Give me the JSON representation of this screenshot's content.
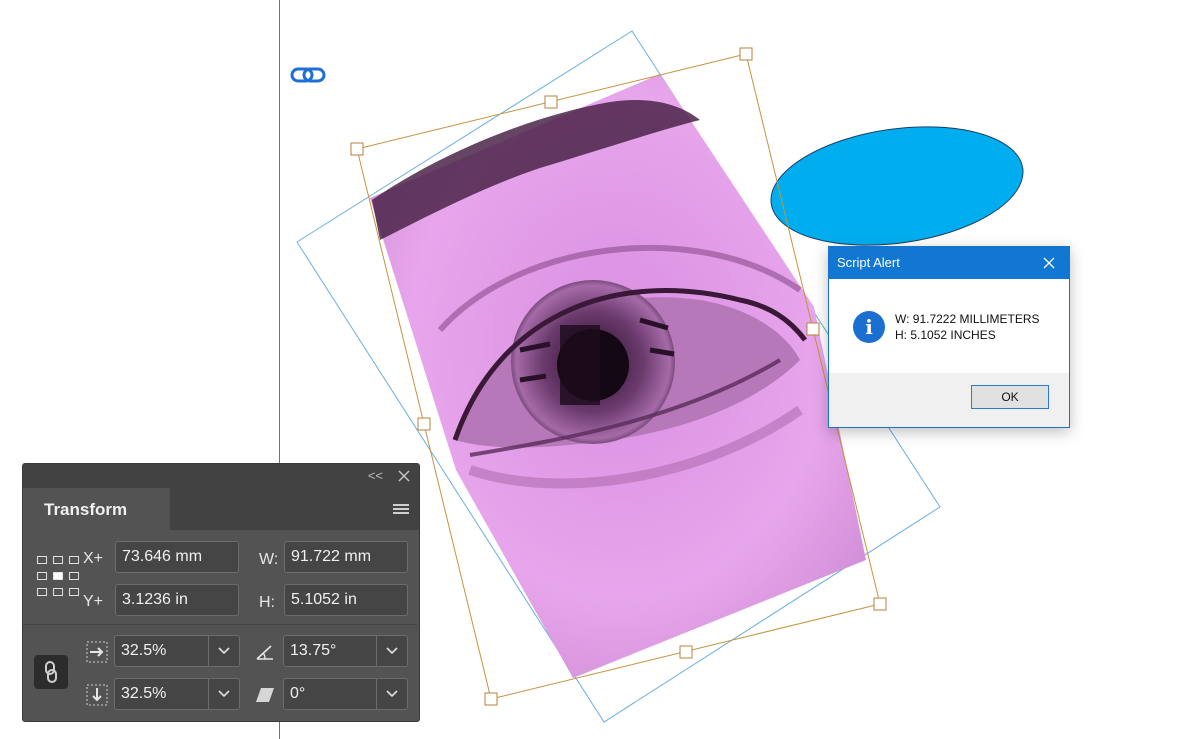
{
  "dialog": {
    "title": "Script Alert",
    "line1": "W: 91.7222 MILLIMETERS",
    "line2": "H: 5.1052 INCHES",
    "info_glyph": "i",
    "ok_label": "OK"
  },
  "panel": {
    "collapse_glyph": "<<",
    "tab_label": "Transform",
    "x_label": "X+",
    "y_label": "Y+",
    "w_label": "W:",
    "h_label": "H:",
    "x_value": "73.646 mm",
    "y_value": "3.1236 in",
    "w_value": "91.722 mm",
    "h_value": "5.1052 in",
    "scale_x": "32.5%",
    "scale_y": "32.5%",
    "rotation": "13.75°",
    "shear": "0°"
  },
  "colors": {
    "guide": "#c03cc0",
    "selection": "#c8913f",
    "bounds": "#6aaee0",
    "ellipse": "#00aeef",
    "photo_tint": "#e59be8",
    "dialog_title": "#1177d3"
  },
  "icons": {
    "canvas_link": "chain-link-icon",
    "info": "info-icon",
    "close": "close-icon",
    "menu": "hamburger-menu-icon",
    "constrain": "chain-link-icon",
    "scale_x": "arrow-right-icon",
    "scale_y": "arrow-down-icon",
    "rotate": "angle-icon",
    "shear": "shear-icon"
  }
}
